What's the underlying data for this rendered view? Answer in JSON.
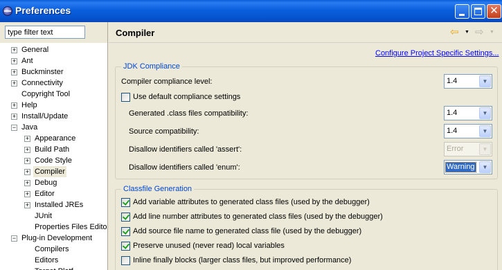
{
  "window": {
    "title": "Preferences",
    "buttons": {
      "minimize": "minimize",
      "maximize": "maximize",
      "close": "✕"
    }
  },
  "filter": {
    "placeholder": "type filter text",
    "value": "type filter text"
  },
  "tree": [
    {
      "label": "General",
      "expander": "+",
      "level": 0
    },
    {
      "label": "Ant",
      "expander": "+",
      "level": 0
    },
    {
      "label": "Buckminster",
      "expander": "+",
      "level": 0
    },
    {
      "label": "Connectivity",
      "expander": "+",
      "level": 0
    },
    {
      "label": "Copyright Tool",
      "expander": "",
      "level": 0
    },
    {
      "label": "Help",
      "expander": "+",
      "level": 0
    },
    {
      "label": "Install/Update",
      "expander": "+",
      "level": 0
    },
    {
      "label": "Java",
      "expander": "−",
      "level": 0
    },
    {
      "label": "Appearance",
      "expander": "+",
      "level": 1
    },
    {
      "label": "Build Path",
      "expander": "+",
      "level": 1
    },
    {
      "label": "Code Style",
      "expander": "+",
      "level": 1
    },
    {
      "label": "Compiler",
      "expander": "+",
      "level": 1,
      "selected": true
    },
    {
      "label": "Debug",
      "expander": "+",
      "level": 1
    },
    {
      "label": "Editor",
      "expander": "+",
      "level": 1
    },
    {
      "label": "Installed JREs",
      "expander": "+",
      "level": 1
    },
    {
      "label": "JUnit",
      "expander": "",
      "level": 1
    },
    {
      "label": "Properties Files Edito",
      "expander": "",
      "level": 1
    },
    {
      "label": "Plug-in Development",
      "expander": "−",
      "level": 0
    },
    {
      "label": "Compilers",
      "expander": "",
      "level": 1
    },
    {
      "label": "Editors",
      "expander": "",
      "level": 1
    },
    {
      "label": "Target Platf",
      "expander": "",
      "level": 1
    }
  ],
  "page": {
    "title": "Compiler",
    "nav": {
      "back_icon": "⇦",
      "forward_icon": "⇨",
      "dropdown": "▼"
    },
    "config_link": "Configure Project Specific Settings..."
  },
  "jdk": {
    "title": "JDK Compliance",
    "compliance_label": "Compiler compliance level:",
    "compliance_value": "1.4",
    "use_default_label": "Use default compliance settings",
    "use_default_checked": false,
    "generated_label": "Generated .class files compatibility:",
    "generated_value": "1.4",
    "source_label": "Source compatibility:",
    "source_value": "1.4",
    "assert_label": "Disallow identifiers called 'assert':",
    "assert_value": "Error",
    "enum_label": "Disallow identifiers called 'enum':",
    "enum_value": "Warning",
    "combo_arrow": "▼"
  },
  "classfile": {
    "title": "Classfile Generation",
    "options": [
      {
        "label": "Add variable attributes to generated class files (used by the debugger)",
        "checked": true
      },
      {
        "label": "Add line number attributes to generated class files (used by the debugger)",
        "checked": true
      },
      {
        "label": "Add source file name to generated class file (used by the debugger)",
        "checked": true
      },
      {
        "label": "Preserve unused (never read) local variables",
        "checked": true
      },
      {
        "label": "Inline finally blocks (larger class files, but improved performance)",
        "checked": false
      }
    ]
  },
  "colors": {
    "title_bar": "#0a5fd8",
    "group_title": "#0046d5",
    "link": "#0000ff",
    "dialog_bg": "#ece9d8",
    "selection": "#316ac5"
  }
}
